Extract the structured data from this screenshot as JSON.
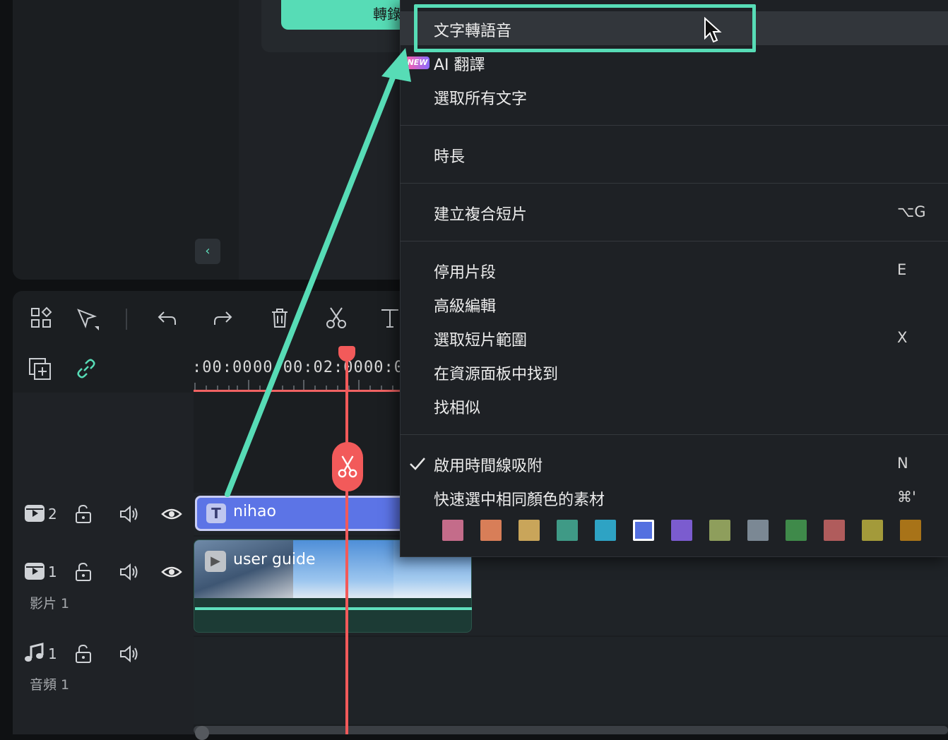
{
  "top": {
    "convert_button_label": "轉錄",
    "collapse_icon": "chevron-left-icon"
  },
  "toolbar": {
    "icons": [
      "layout-icon",
      "select-tool-icon",
      "undo-icon",
      "redo-icon",
      "delete-icon",
      "scissors-icon",
      "text-tool-icon"
    ]
  },
  "ruler": {
    "labels": [
      ":00:00",
      "00:00:02:00",
      "00:0"
    ]
  },
  "tracks": [
    {
      "icon": "video-track-icon",
      "number": "2",
      "name": ""
    },
    {
      "icon": "video-track-icon",
      "number": "1",
      "name": "影片 1"
    },
    {
      "icon": "music-note-icon",
      "number": "1",
      "name": "音頻 1"
    }
  ],
  "clips": {
    "text_clip_label": "nihao",
    "video_clip_label": "user guide"
  },
  "context_menu": {
    "items": [
      {
        "label": "文字轉語音",
        "shortcut": ""
      },
      {
        "label": "AI 翻譯",
        "shortcut": "",
        "badge": "NEW"
      },
      {
        "label": "選取所有文字",
        "shortcut": ""
      },
      {
        "label": "時長",
        "shortcut": ""
      },
      {
        "label": "建立複合短片",
        "shortcut": "⌥G"
      },
      {
        "label": "停用片段",
        "shortcut": "E"
      },
      {
        "label": "高級編輯",
        "shortcut": ""
      },
      {
        "label": "選取短片範圍",
        "shortcut": "X"
      },
      {
        "label": "在資源面板中找到",
        "shortcut": ""
      },
      {
        "label": "找相似",
        "shortcut": ""
      },
      {
        "label": "啟用時間線吸附",
        "shortcut": "N",
        "checked": true
      },
      {
        "label": "快速選中相同顏色的素材",
        "shortcut": "⌘'"
      }
    ],
    "colors": [
      "#c46c8a",
      "#d87e58",
      "#c9a55a",
      "#3f9a86",
      "#2ea3c4",
      "#5470e0",
      "#7b5ccf",
      "#8e9e5c",
      "#7b8894",
      "#3f8a4a",
      "#b05c5c",
      "#a39a3a",
      "#a87318"
    ],
    "selected_color_index": 5
  },
  "accent_color": "#57dcb6"
}
